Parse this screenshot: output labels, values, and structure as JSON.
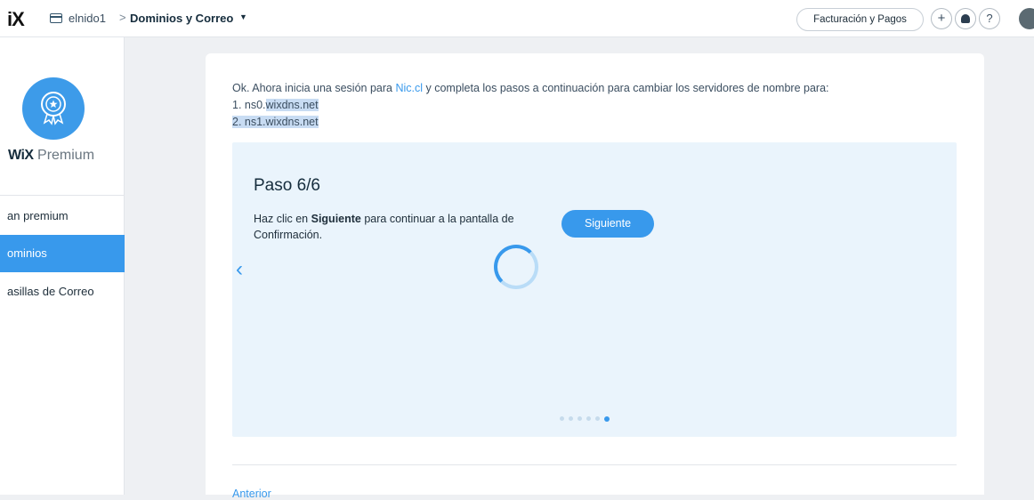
{
  "header": {
    "logo": "iX",
    "site_name": "elnido1",
    "breadcrumb_separator": ">",
    "current_section": "Dominios y Correo",
    "billing_label": "Facturación y Pagos",
    "add_label": "+",
    "help_label": "?"
  },
  "sidebar": {
    "brand_strong": "WiX",
    "brand_rest": " Premium",
    "items": [
      {
        "label": "an premium",
        "active": false
      },
      {
        "label": "ominios",
        "active": true
      },
      {
        "label": "asillas de Correo",
        "active": false
      }
    ]
  },
  "main": {
    "intro_before_link": "Ok. Ahora inicia una sesión para ",
    "intro_link": "Nic.cl",
    "intro_after_link": " y completa los pasos a continuación para cambiar los servidores de nombre para:",
    "ns1_prefix": "1. ns0.",
    "ns1_domain": "wixdns.net",
    "ns2": "2. ns1.wixdns.net",
    "step": {
      "title": "Paso 6/6",
      "text_before": "Haz clic en ",
      "text_bold": "Siguiente",
      "text_after": " para continuar a la pantalla de Confirmación.",
      "next_label": "Siguiente",
      "back_label": "‹",
      "total_steps": 6,
      "current_step": 6
    },
    "footer_link": "Anterior"
  },
  "colors": {
    "accent": "#3899ec",
    "panel": "#eaf4fc",
    "highlight": "#c8dcf3"
  }
}
